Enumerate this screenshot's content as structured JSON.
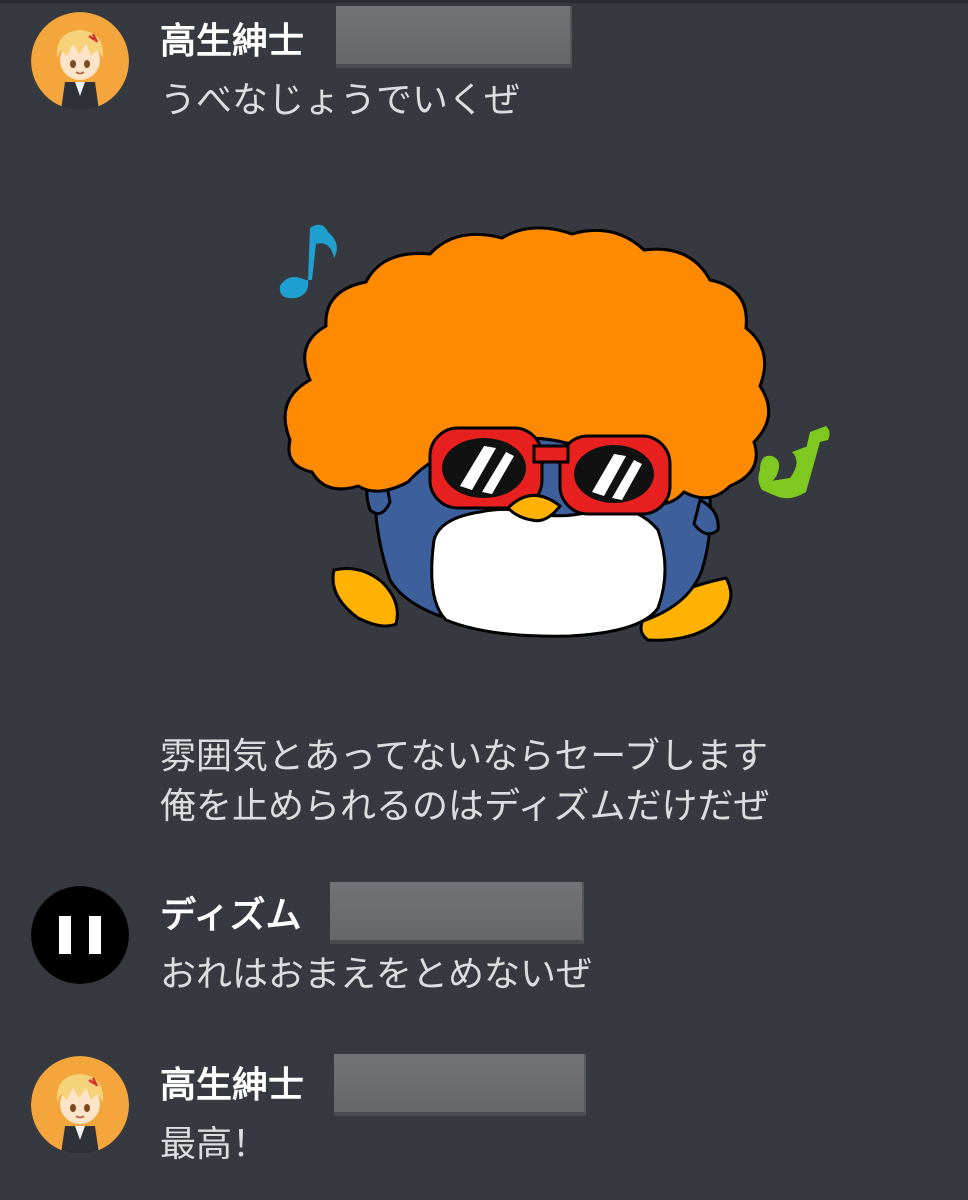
{
  "messages": [
    {
      "author": "高生紳士",
      "lines": [
        "うべなじょうでいくぜ"
      ],
      "avatar_icon": "blond-boy-avatar-icon"
    },
    {
      "author": "高生紳士",
      "sticker_icon": "afro-penguin-sunglasses-sticker",
      "lines": [
        "雰囲気とあってないならセーブします",
        "俺を止められるのはディズムだけだぜ"
      ]
    },
    {
      "author": "ディズム",
      "lines": [
        "おれはおまえをとめないぜ"
      ],
      "avatar_icon": "black-circle-eyes-avatar-icon"
    },
    {
      "author": "高生紳士",
      "lines": [
        "最高！"
      ],
      "avatar_icon": "blond-boy-avatar-icon"
    }
  ],
  "colors": {
    "background": "#36393f",
    "username": "#ffffff",
    "message_text": "#dcddde",
    "redaction": "#6c6d70",
    "afro": "#ff8a00",
    "penguin_body": "#3d5f9c",
    "sunglasses_frame": "#e82020",
    "note_blue": "#1ea0d0",
    "note_green": "#7ec820"
  }
}
